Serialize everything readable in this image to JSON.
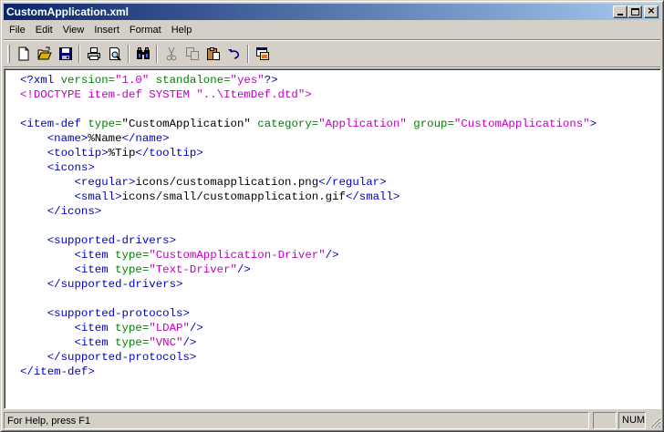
{
  "window": {
    "title": "CustomApplication.xml"
  },
  "title_buttons": {
    "minimize": "_",
    "maximize": "□",
    "close": "×"
  },
  "menu": [
    "File",
    "Edit",
    "View",
    "Insert",
    "Format",
    "Help"
  ],
  "toolbar": {
    "buttons": [
      "new-icon",
      "open-icon",
      "save-icon",
      "print-icon",
      "print-preview-icon",
      "find-icon",
      "cut-icon",
      "copy-icon",
      "paste-icon",
      "undo-icon",
      "properties-icon"
    ],
    "disabled": [
      "cut-icon",
      "copy-icon"
    ]
  },
  "editor": {
    "lines": [
      [
        [
          "pi",
          "<?xml "
        ],
        [
          "attr",
          "version="
        ],
        [
          "val",
          "\"1.0\""
        ],
        [
          "attr",
          " standalone="
        ],
        [
          "val",
          "\"yes\""
        ],
        [
          "pi",
          "?>"
        ]
      ],
      [
        [
          "doctype",
          "<!DOCTYPE item-def SYSTEM \"..\\ItemDef.dtd\">"
        ]
      ],
      [],
      [
        [
          "tag",
          "<item-def "
        ],
        [
          "attr",
          "type="
        ],
        [
          "text",
          "\"CustomApplication\" "
        ],
        [
          "attr",
          "category="
        ],
        [
          "val",
          "\"Application\" "
        ],
        [
          "attr",
          "group="
        ],
        [
          "val",
          "\"CustomApplications\""
        ],
        [
          "tag",
          ">"
        ]
      ],
      [
        [
          "text",
          "    "
        ],
        [
          "tag",
          "<name>"
        ],
        [
          "text",
          "%Name"
        ],
        [
          "tag",
          "</name>"
        ]
      ],
      [
        [
          "text",
          "    "
        ],
        [
          "tag",
          "<tooltip>"
        ],
        [
          "text",
          "%Tip"
        ],
        [
          "tag",
          "</tooltip>"
        ]
      ],
      [
        [
          "text",
          "    "
        ],
        [
          "tag",
          "<icons>"
        ]
      ],
      [
        [
          "text",
          "        "
        ],
        [
          "tag",
          "<regular>"
        ],
        [
          "text",
          "icons/customapplication.png"
        ],
        [
          "tag",
          "</regular>"
        ]
      ],
      [
        [
          "text",
          "        "
        ],
        [
          "tag",
          "<small>"
        ],
        [
          "text",
          "icons/small/customapplication.gif"
        ],
        [
          "tag",
          "</small>"
        ]
      ],
      [
        [
          "text",
          "    "
        ],
        [
          "tag",
          "</icons>"
        ]
      ],
      [],
      [
        [
          "text",
          "    "
        ],
        [
          "tag",
          "<supported-drivers>"
        ]
      ],
      [
        [
          "text",
          "        "
        ],
        [
          "tag",
          "<item "
        ],
        [
          "attr",
          "type="
        ],
        [
          "val",
          "\"CustomApplication-Driver\""
        ],
        [
          "tag",
          "/>"
        ]
      ],
      [
        [
          "text",
          "        "
        ],
        [
          "tag",
          "<item "
        ],
        [
          "attr",
          "type="
        ],
        [
          "val",
          "\"Text-Driver\""
        ],
        [
          "tag",
          "/>"
        ]
      ],
      [
        [
          "text",
          "    "
        ],
        [
          "tag",
          "</supported-drivers>"
        ]
      ],
      [],
      [
        [
          "text",
          "    "
        ],
        [
          "tag",
          "<supported-protocols>"
        ]
      ],
      [
        [
          "text",
          "        "
        ],
        [
          "tag",
          "<item "
        ],
        [
          "attr",
          "type="
        ],
        [
          "val",
          "\"LDAP\""
        ],
        [
          "tag",
          "/>"
        ]
      ],
      [
        [
          "text",
          "        "
        ],
        [
          "tag",
          "<item "
        ],
        [
          "attr",
          "type="
        ],
        [
          "val",
          "\"VNC\""
        ],
        [
          "tag",
          "/>"
        ]
      ],
      [
        [
          "text",
          "    "
        ],
        [
          "tag",
          "</supported-protocols>"
        ]
      ],
      [
        [
          "tag",
          "</item-def>"
        ]
      ]
    ]
  },
  "statusbar": {
    "text": "For Help, press F1",
    "caps": "",
    "num": "NUM"
  }
}
